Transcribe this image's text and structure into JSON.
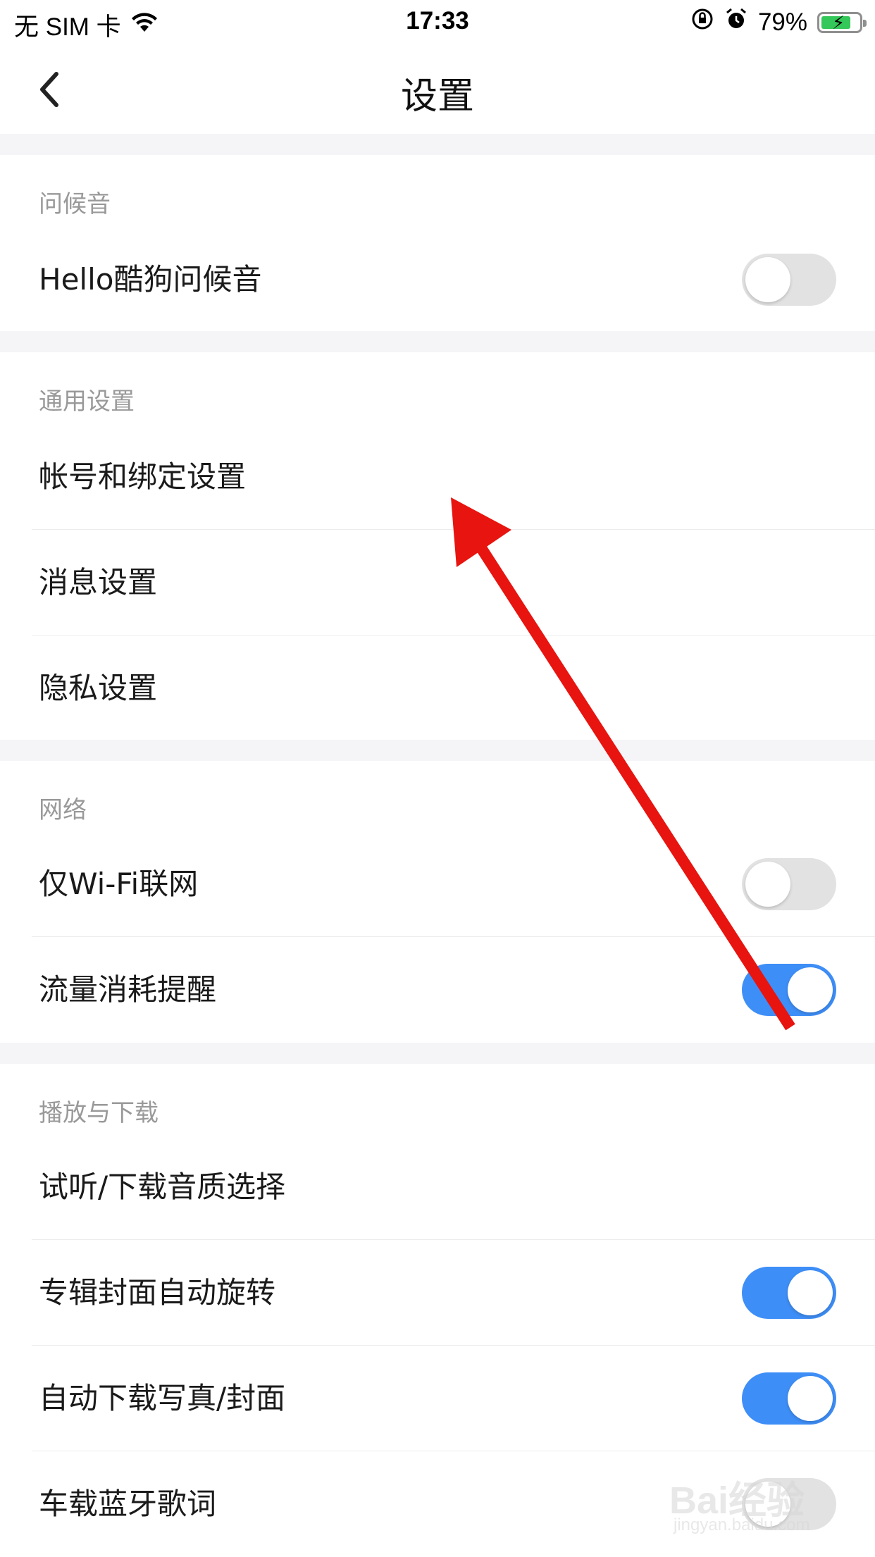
{
  "status_bar": {
    "carrier": "无 SIM 卡",
    "time": "17:33",
    "battery_percent": "79%",
    "battery_level": 0.79,
    "icons": [
      "wifi-icon",
      "orientation-lock-icon",
      "alarm-icon",
      "battery-charging-icon"
    ]
  },
  "nav": {
    "title": "设置",
    "back_icon": "chevron-left-icon"
  },
  "sections": {
    "greeting": {
      "title": "问候音",
      "items": [
        {
          "label": "Hello酷狗问候音",
          "toggle": false
        }
      ]
    },
    "general": {
      "title": "通用设置",
      "items": [
        {
          "label": "帐号和绑定设置"
        },
        {
          "label": "消息设置"
        },
        {
          "label": "隐私设置"
        }
      ]
    },
    "network": {
      "title": "网络",
      "items": [
        {
          "label": "仅Wi-Fi联网",
          "toggle": false
        },
        {
          "label": "流量消耗提醒",
          "toggle": true
        }
      ]
    },
    "playback": {
      "title": "播放与下载",
      "items": [
        {
          "label": "试听/下载音质选择"
        },
        {
          "label": "专辑封面自动旋转",
          "toggle": true
        },
        {
          "label": "自动下载写真/封面",
          "toggle": true
        },
        {
          "label": "车载蓝牙歌词",
          "toggle": false
        }
      ]
    }
  },
  "colors": {
    "accent": "#3e8ef7",
    "toggle_off": "#e2e2e2",
    "annotation_arrow": "#e8140f",
    "section_gap": "#f5f5f7"
  },
  "watermark": {
    "brand": "Bai经验",
    "url": "jingyan.baidu.com"
  }
}
